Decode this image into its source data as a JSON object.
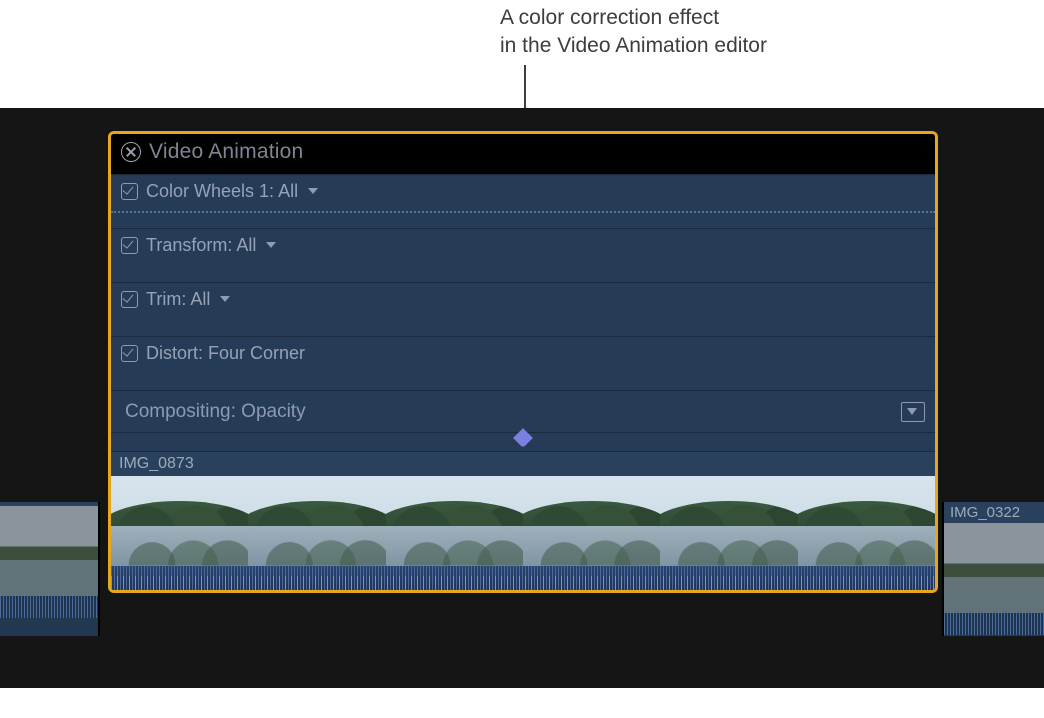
{
  "callout": {
    "line1": "A color correction effect",
    "line2": "in the Video Animation editor"
  },
  "panel": {
    "title": "Video Animation",
    "rows": [
      {
        "label_prefix": "Color Wheels 1:",
        "label_value": " All",
        "has_chevron": true,
        "has_checkbox": true,
        "dotted": true
      },
      {
        "label_prefix": "Transform:",
        "label_value": " All",
        "has_chevron": true,
        "has_checkbox": true,
        "dotted": false
      },
      {
        "label_prefix": "Trim:",
        "label_value": " All",
        "has_chevron": true,
        "has_checkbox": true,
        "dotted": false
      },
      {
        "label_prefix": "Distort:",
        "label_value": " Four Corner",
        "has_chevron": false,
        "has_checkbox": true,
        "dotted": false
      }
    ],
    "compositing_label": "Compositing: Opacity",
    "clip_name": "IMG_0873"
  },
  "neighbors": {
    "left_label": "",
    "right_label": "IMG_0322"
  }
}
